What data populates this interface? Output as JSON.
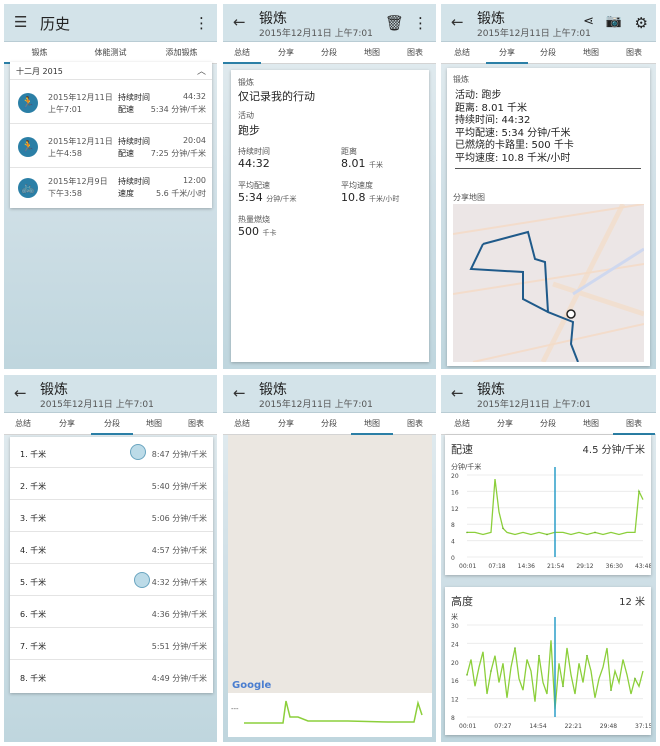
{
  "s1": {
    "title": "历史",
    "tabs": [
      "锻炼",
      "体能测试",
      "添加锻炼"
    ],
    "month": "十二月 2015",
    "items": [
      {
        "date": "2015年12月11日",
        "time": "上午7:01",
        "l1": "持续时间",
        "v1": "44:32",
        "l2": "配速",
        "v2": "5:34 分钟/千米",
        "icon": "runner"
      },
      {
        "date": "2015年12月11日",
        "time": "上午4:58",
        "l1": "持续时间",
        "v1": "20:04",
        "l2": "配速",
        "v2": "7:25 分钟/千米",
        "icon": "runner"
      },
      {
        "date": "2015年12月9日",
        "time": "下午3:58",
        "l1": "持续时间",
        "v1": "12:00",
        "l2": "速度",
        "v2": "5.6 千米/小时",
        "icon": "bike"
      }
    ]
  },
  "s2": {
    "title": "锻炼",
    "subtitle": "2015年12月11日 上午7:01",
    "tabs": [
      "总结",
      "分享",
      "分段",
      "地图",
      "图表"
    ],
    "section": "锻炼",
    "desc": "仅记录我的行动",
    "activity_label": "活动",
    "activity": "跑步",
    "stats": [
      {
        "label": "持续时间",
        "value": "44:32",
        "unit": ""
      },
      {
        "label": "距离",
        "value": "8.01",
        "unit": "千米"
      },
      {
        "label": "平均配速",
        "value": "5:34",
        "unit": "分钟/千米"
      },
      {
        "label": "平均速度",
        "value": "10.8",
        "unit": "千米/小时"
      },
      {
        "label": "热量燃烧",
        "value": "500",
        "unit": "千卡"
      }
    ]
  },
  "s3": {
    "title": "锻炼",
    "subtitle": "2015年12月11日 上午7:01",
    "tabs": [
      "总结",
      "分享",
      "分段",
      "地图",
      "图表"
    ],
    "section": "锻炼",
    "lines": [
      "活动: 跑步",
      "距离: 8.01 千米",
      "持续时间: 44:32",
      "平均配速: 5:34 分钟/千米",
      "已燃烧的卡路里: 500 千卡",
      "平均速度: 10.8 千米/小时"
    ],
    "map_title": "分享地图"
  },
  "s4": {
    "title": "锻炼",
    "subtitle": "2015年12月11日 上午7:01",
    "tabs": [
      "总结",
      "分享",
      "分段",
      "地图",
      "图表"
    ],
    "splits": [
      {
        "n": "1. 千米",
        "v": "8:47 分钟/千米",
        "slow": true
      },
      {
        "n": "2. 千米",
        "v": "5:40 分钟/千米"
      },
      {
        "n": "3. 千米",
        "v": "5:06 分钟/千米"
      },
      {
        "n": "4. 千米",
        "v": "4:57 分钟/千米"
      },
      {
        "n": "5. 千米",
        "v": "4:32 分钟/千米",
        "fast": true
      },
      {
        "n": "6. 千米",
        "v": "4:36 分钟/千米"
      },
      {
        "n": "7. 千米",
        "v": "5:51 分钟/千米"
      },
      {
        "n": "8. 千米",
        "v": "4:49 分钟/千米"
      }
    ]
  },
  "s5": {
    "title": "锻炼",
    "subtitle": "2015年12月11日 上午7:01",
    "tabs": [
      "总结",
      "分享",
      "分段",
      "地图",
      "图表"
    ],
    "map_brand": "Google",
    "mini_label": "---"
  },
  "s6": {
    "title": "锻炼",
    "subtitle": "2015年12月11日 上午7:01",
    "tabs": [
      "总结",
      "分享",
      "分段",
      "地图",
      "图表"
    ]
  },
  "chart_data": [
    {
      "type": "line",
      "title": "配速",
      "summary": "4.5 分钟/千米",
      "ylabel": "分钟/千米",
      "ylim": [
        0,
        20
      ],
      "yticks": [
        "20",
        "16",
        "12",
        "8",
        "4",
        "0"
      ],
      "xticks": [
        "00:01",
        "07:18",
        "14:36",
        "21:54",
        "29:12",
        "36:30",
        "43:48"
      ],
      "x": [
        0,
        2,
        4,
        6,
        7,
        8,
        9,
        10,
        12,
        14,
        16,
        18,
        20,
        21.9,
        24,
        26,
        28,
        30,
        32,
        34,
        36,
        38,
        40,
        42,
        43,
        44
      ],
      "series": [
        {
          "values": [
            6,
            6,
            5.5,
            6,
            19,
            11,
            7,
            6,
            5.5,
            6,
            5.5,
            6,
            5.5,
            6,
            6,
            5.5,
            6,
            5.5,
            6,
            5.5,
            6,
            5.5,
            6,
            6,
            16,
            14
          ]
        }
      ]
    },
    {
      "type": "line",
      "title": "高度",
      "summary": "12 米",
      "ylabel": "米",
      "ylim": [
        6,
        30
      ],
      "yticks": [
        "30",
        "24",
        "20",
        "16",
        "12",
        "8"
      ],
      "xticks": [
        "00:01",
        "07:27",
        "14:54",
        "22:21",
        "29:48",
        "37:15"
      ],
      "x": [
        0,
        1,
        2,
        3,
        4,
        5,
        6,
        7,
        8,
        9,
        10,
        11,
        12,
        13,
        14,
        15,
        16,
        17,
        18,
        19,
        20,
        21,
        22,
        23,
        24,
        25,
        26,
        27,
        28,
        29,
        30,
        31,
        32,
        33,
        34,
        35,
        36,
        37,
        38,
        39,
        40,
        41,
        42,
        43,
        44
      ],
      "series": [
        {
          "values": [
            17,
            21,
            14,
            19,
            23,
            12,
            18,
            22,
            15,
            20,
            11,
            19,
            24,
            16,
            13,
            21,
            18,
            10,
            22,
            15,
            12,
            26,
            8,
            20,
            14,
            24,
            17,
            12,
            20,
            15,
            22,
            18,
            11,
            16,
            19,
            24,
            13,
            18,
            15,
            21,
            17,
            12,
            16,
            14,
            18
          ]
        }
      ]
    }
  ]
}
